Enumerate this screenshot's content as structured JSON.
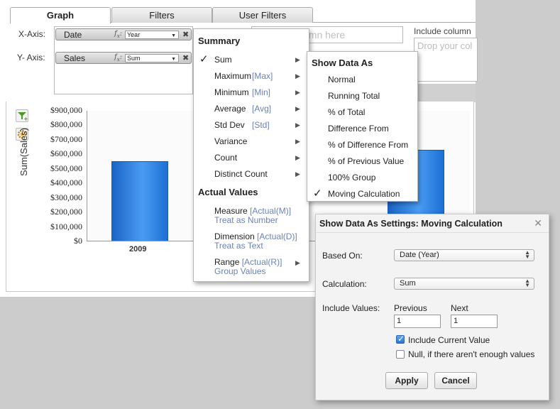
{
  "tabs": [
    "Graph",
    "Filters",
    "User Filters"
  ],
  "axes": {
    "x_label": "X-Axis:",
    "y_label": "Y- Axis:",
    "x_pill": {
      "name": "Date",
      "function": "Year"
    },
    "y_pill": {
      "name": "Sales",
      "function": "Sum"
    },
    "fx_icon": "fx-icon",
    "remove_icon": "✖"
  },
  "columns_placeholder": "umn here",
  "include_columns": {
    "label": "Include column",
    "placeholder": "Drop your col"
  },
  "icons": {
    "side1": "filter-add-icon",
    "side2": "settings-gear-icon"
  },
  "chart_data": {
    "type": "bar",
    "categories": [
      "2009",
      ""
    ],
    "values": [
      550000,
      625000
    ],
    "ylabel": "Sum(Sales)",
    "ylim": [
      0,
      900000
    ],
    "yticks": [
      "$900,000",
      "$800,000",
      "$700,000",
      "$600,000",
      "$500,000",
      "$400,000",
      "$300,000",
      "$200,000",
      "$100,000",
      "$0"
    ],
    "grid": false,
    "bar_color": "#2f80de"
  },
  "summary_menu": {
    "heading": "Summary",
    "items": [
      {
        "label": "Sum",
        "tag": "",
        "checked": true
      },
      {
        "label": "Maximum",
        "tag": "[Max]"
      },
      {
        "label": "Minimum",
        "tag": "[Min]"
      },
      {
        "label": "Average",
        "tag": "[Avg]"
      },
      {
        "label": "Std Dev",
        "tag": "[Std]"
      },
      {
        "label": "Variance",
        "tag": ""
      },
      {
        "label": "Count",
        "tag": ""
      },
      {
        "label": "Distinct Count",
        "tag": ""
      }
    ],
    "actual_heading": "Actual Values",
    "actual_items": [
      {
        "label": "Measure",
        "tag": "[Actual(M)]",
        "sub": "Treat as Number"
      },
      {
        "label": "Dimension",
        "tag": "[Actual(D)]",
        "sub": "Treat as Text"
      },
      {
        "label": "Range",
        "tag": "[Actual(R)]",
        "sub": "Group Values"
      }
    ]
  },
  "show_data_menu": {
    "heading": "Show Data As",
    "items": [
      "Normal",
      "Running Total",
      "% of Total",
      "Difference From",
      "% of Difference From",
      "% of Previous Value",
      "100% Group",
      "Moving Calculation"
    ],
    "checked_index": 7
  },
  "dialog": {
    "title": "Show Data As Settings: Moving Calculation",
    "close": "✕",
    "based_on_label": "Based On:",
    "based_on_value": "Date (Year)",
    "calculation_label": "Calculation:",
    "calculation_value": "Sum",
    "include_values_label": "Include Values:",
    "previous_label": "Previous",
    "previous_value": "1",
    "next_label": "Next",
    "next_value": "1",
    "include_current_label": "Include Current Value",
    "include_current_checked": true,
    "null_label": "Null, if there aren't enough values",
    "null_checked": false,
    "apply_label": "Apply",
    "cancel_label": "Cancel"
  },
  "colors": {
    "accent": "#2f80de",
    "tag_color": "#6b82b5",
    "background": "#cccccc"
  }
}
